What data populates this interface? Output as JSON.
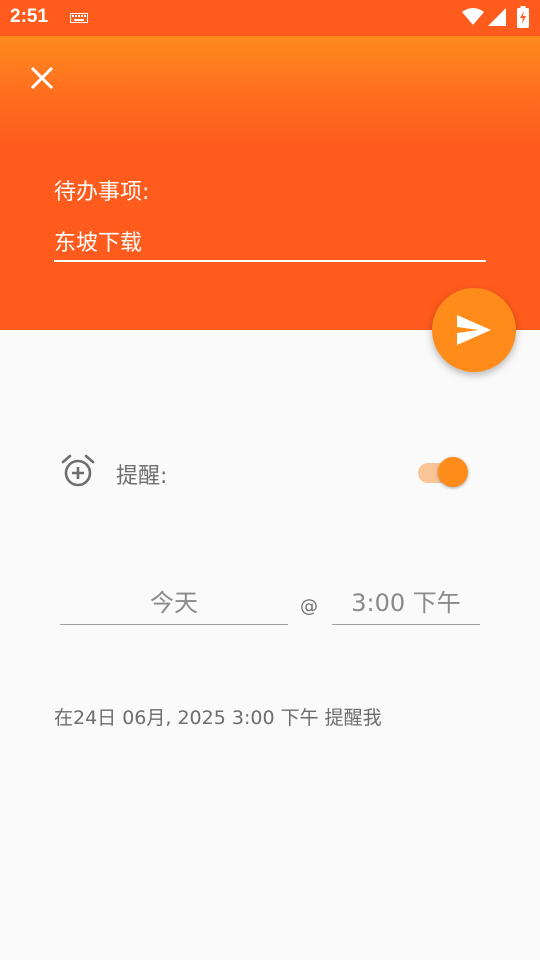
{
  "status_bar": {
    "time": "2:51",
    "icons": [
      "keyboard-icon",
      "wifi-icon",
      "cell-signal-icon",
      "battery-charging-icon"
    ]
  },
  "header": {
    "close_icon": "close-icon",
    "todo_label": "待办事项:",
    "todo_value": "东坡下载"
  },
  "fab": {
    "icon": "send-icon"
  },
  "reminder": {
    "icon": "alarm-add-icon",
    "label": "提醒:",
    "enabled": true
  },
  "schedule": {
    "date": "今天",
    "at": "@",
    "time": "3:00 下午"
  },
  "summary": "在24日 06月, 2025 3:00 下午 提醒我",
  "colors": {
    "header_orange": "#ff5b1d",
    "header_top_orange": "#ff8a1f",
    "accent": "#ff8c1a",
    "switch_track": "#f9c596",
    "background": "#fafafa",
    "secondary_text": "#6d6d6d"
  }
}
